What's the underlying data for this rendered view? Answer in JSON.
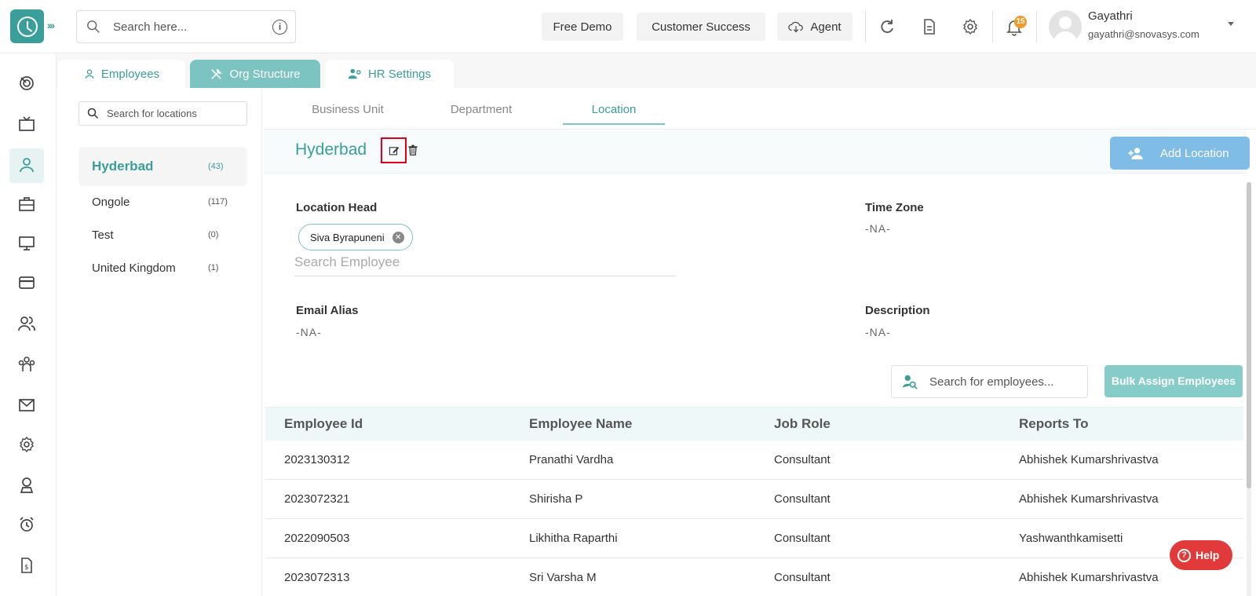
{
  "topbar": {
    "search_placeholder": "Search here...",
    "free_demo": "Free Demo",
    "customer_success": "Customer Success",
    "agent": "Agent",
    "notification_count": "15",
    "user_name": "Gayathri",
    "user_email": "gayathri@snovasys.com"
  },
  "module_tabs": [
    {
      "label": "Employees",
      "icon": "person-icon"
    },
    {
      "label": "Org Structure",
      "icon": "tools-icon"
    },
    {
      "label": "HR Settings",
      "icon": "people-gear-icon"
    }
  ],
  "location_search_placeholder": "Search for locations",
  "locations": [
    {
      "name": "Hyderbad",
      "count": "(43)"
    },
    {
      "name": "Ongole",
      "count": "(117)"
    },
    {
      "name": "Test",
      "count": "(0)"
    },
    {
      "name": "United Kingdom",
      "count": "(1)"
    }
  ],
  "sub_tabs": [
    "Business Unit",
    "Department",
    "Location"
  ],
  "detail": {
    "location_name": "Hyderbad",
    "add_location": "Add Location",
    "location_head_label": "Location Head",
    "location_head_chip": "Siva Byrapuneni",
    "search_employee_placeholder": "Search Employee",
    "time_zone_label": "Time Zone",
    "time_zone_value": "-NA-",
    "email_alias_label": "Email Alias",
    "email_alias_value": "-NA-",
    "description_label": "Description",
    "description_value": "-NA-"
  },
  "employees_search_placeholder": "Search for employees...",
  "bulk_assign": "Bulk Assign Employees",
  "table": {
    "headers": [
      "Employee Id",
      "Employee Name",
      "Job Role",
      "Reports To"
    ],
    "rows": [
      [
        "2023130312",
        "Pranathi Vardha",
        "Consultant",
        "Abhishek Kumarshrivastva"
      ],
      [
        "2023072321",
        "Shirisha P",
        "Consultant",
        "Abhishek Kumarshrivastva"
      ],
      [
        "2022090503",
        "Likhitha Raparthi",
        "Consultant",
        "Yashwanthkamisetti"
      ],
      [
        "2023072313",
        "Sri Varsha M",
        "Consultant",
        "Abhishek Kumarshrivastva"
      ]
    ]
  },
  "help_label": "Help",
  "colors": {
    "accent": "#3a9e9b",
    "accent_light": "#7cc4c2",
    "add_button": "#7fbde6",
    "highlight": "#e0001b"
  }
}
